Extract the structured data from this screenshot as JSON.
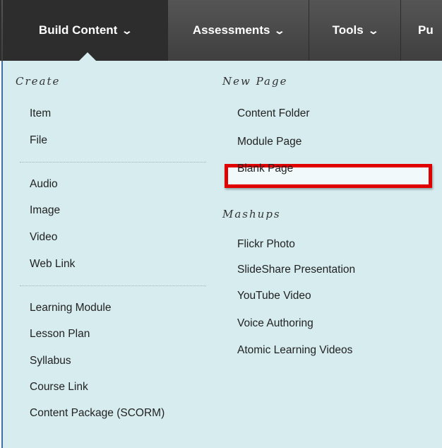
{
  "tabs": [
    {
      "label": "Build Content",
      "chevron": "chevron-down-icon",
      "active": true
    },
    {
      "label": "Assessments",
      "chevron": "chevron-down-icon",
      "active": false
    },
    {
      "label": "Tools",
      "chevron": "chevron-down-icon",
      "active": false
    },
    {
      "label": "Pu",
      "active": false
    }
  ],
  "menu": {
    "create": {
      "heading": "Create",
      "items": [
        "Item",
        "File",
        "Audio",
        "Image",
        "Video",
        "Web Link",
        "Learning Module",
        "Lesson Plan",
        "Syllabus",
        "Course Link",
        "Content Package (SCORM)"
      ]
    },
    "new_page": {
      "heading": "New Page",
      "items": [
        "Content Folder",
        "Module Page",
        "Blank Page"
      ]
    },
    "mashups": {
      "heading": "Mashups",
      "items": [
        "Flickr Photo",
        "SlideShare Presentation",
        "YouTube Video",
        "Voice Authoring",
        "Atomic Learning Videos"
      ]
    }
  },
  "colors": {
    "tabbar": "#3f3f3f",
    "active_tab": "#2d2d2d",
    "panel": "#d6ecef",
    "highlight_border": "#e00000"
  }
}
